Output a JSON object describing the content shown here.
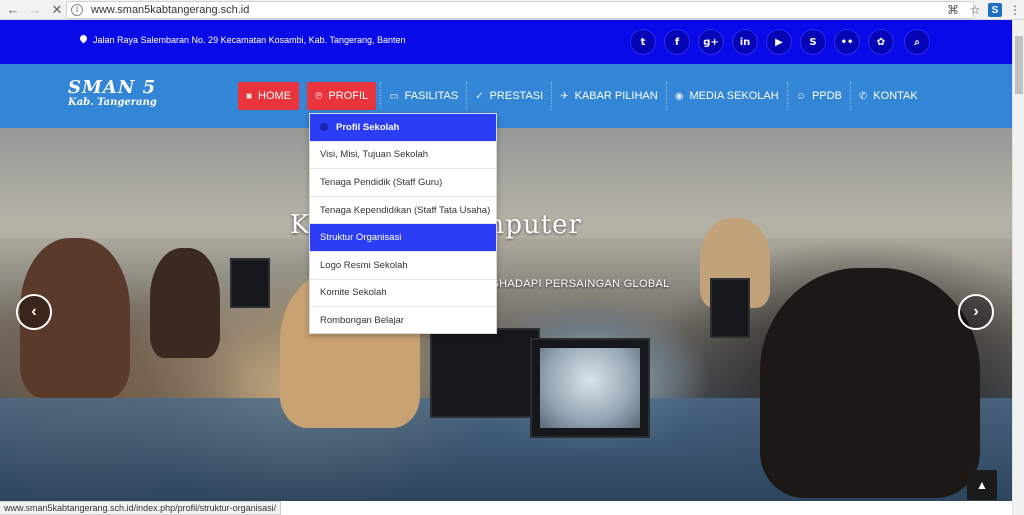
{
  "browser": {
    "url": "www.sman5kabtangerang.sch.id",
    "back_icon": "arrow-left-icon",
    "forward_icon": "arrow-right-icon",
    "stop_icon": "close-icon"
  },
  "topbar": {
    "address": "Jalan Raya Salembaran No. 29 Kecamatan Kosambi, Kab. Tangerang, Banten",
    "social": [
      {
        "name": "twitter-icon",
        "glyph": "t"
      },
      {
        "name": "facebook-icon",
        "glyph": "f"
      },
      {
        "name": "google-plus-icon",
        "glyph": "g+"
      },
      {
        "name": "linkedin-icon",
        "glyph": "in"
      },
      {
        "name": "youtube-icon",
        "glyph": "▶"
      },
      {
        "name": "skype-icon",
        "glyph": "S"
      },
      {
        "name": "flickr-icon",
        "glyph": "••"
      },
      {
        "name": "foursquare-icon",
        "glyph": "✿"
      }
    ],
    "search_glyph": "⌕"
  },
  "logo": {
    "line1": "SMAN 5",
    "line2": "Kab. Tangerang"
  },
  "menu": [
    {
      "label": "HOME",
      "icon": "■"
    },
    {
      "label": "PROFIL",
      "icon": "℗"
    },
    {
      "label": "FASILITAS",
      "icon": "▭"
    },
    {
      "label": "PRESTASI",
      "icon": "✓"
    },
    {
      "label": "KABAR PILIHAN",
      "icon": "✈"
    },
    {
      "label": "MEDIA SEKOLAH",
      "icon": "◉"
    },
    {
      "label": "PPDB",
      "icon": "☺"
    },
    {
      "label": "KONTAK",
      "icon": "✆"
    }
  ],
  "dropdown": {
    "header": "Profil Sekolah",
    "items": [
      "Visi, Misi, Tujuan Sekolah",
      "Tenaga Pendidik (Staff Guru)",
      "Tenaga Kependidikan (Staff Tata Usaha)",
      "Struktur Organisasi",
      "Logo Resmi Sekolah",
      "Komite Sekolah",
      "Rombongan Belajar"
    ],
    "highlighted_index": 3
  },
  "hero": {
    "title": "K            um Lab. Komputer",
    "subtitle": "NGHADAPI PERSAINGAN GLOBAL",
    "prev_glyph": "‹",
    "next_glyph": "›"
  },
  "status_url": "www.sman5kabtangerang.sch.id/index.php/profil/struktur-organisasi/",
  "totop_glyph": "▲",
  "colors": {
    "topbar": "#0a0ae8",
    "header": "#3386d6",
    "accent_red": "#e8343a",
    "dropdown_highlight": "#2b3ef5"
  }
}
